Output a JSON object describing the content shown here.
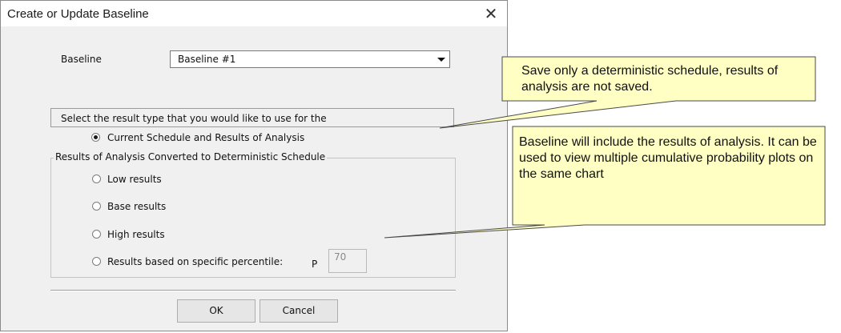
{
  "dialog": {
    "title": "Create or Update Baseline",
    "close_symbol": "✕"
  },
  "baseline": {
    "label": "Baseline",
    "selected": "Baseline #1"
  },
  "result_type_prompt": "Select the result type that you would like to use for the",
  "options": {
    "current": {
      "label": "Current Schedule and Results of Analysis",
      "checked": true
    },
    "group_title": "Results of Analysis Converted to Deterministic Schedule",
    "low": {
      "label": "Low results",
      "checked": false
    },
    "base": {
      "label": "Base results",
      "checked": false
    },
    "high": {
      "label": "High results",
      "checked": false
    },
    "percentile": {
      "label": "Results based on specific percentile:",
      "checked": false,
      "prefix": "P",
      "value": "70"
    }
  },
  "buttons": {
    "ok": "OK",
    "cancel": "Cancel"
  },
  "callouts": {
    "top": "Save only a deterministic schedule, results of analysis are not saved.",
    "bottom": "Baseline will include the results of analysis. It can be used to view multiple cumulative probability plots on the same chart"
  },
  "colors": {
    "callout_fill": "#ffffc4",
    "dialog_bg": "#f0f0f0"
  }
}
